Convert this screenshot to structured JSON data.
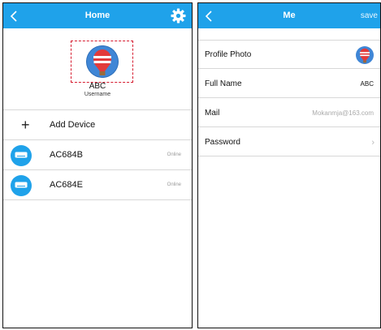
{
  "home": {
    "title": "Home",
    "profile": {
      "name": "ABC",
      "username_label": "Username"
    },
    "add_device_label": "Add Device",
    "devices": [
      {
        "name": "AC684B",
        "status": "Online"
      },
      {
        "name": "AC684E",
        "status": "Online"
      }
    ]
  },
  "me": {
    "title": "Me",
    "save_label": "save",
    "rows": [
      {
        "label": "Profile Photo"
      },
      {
        "label": "Full Name",
        "value": "ABC"
      },
      {
        "label": "Mail",
        "value": "Mokanmja@163.com"
      },
      {
        "label": "Password"
      }
    ]
  },
  "colors": {
    "accent": "#1fa2ea",
    "highlight": "#d61b2f"
  }
}
